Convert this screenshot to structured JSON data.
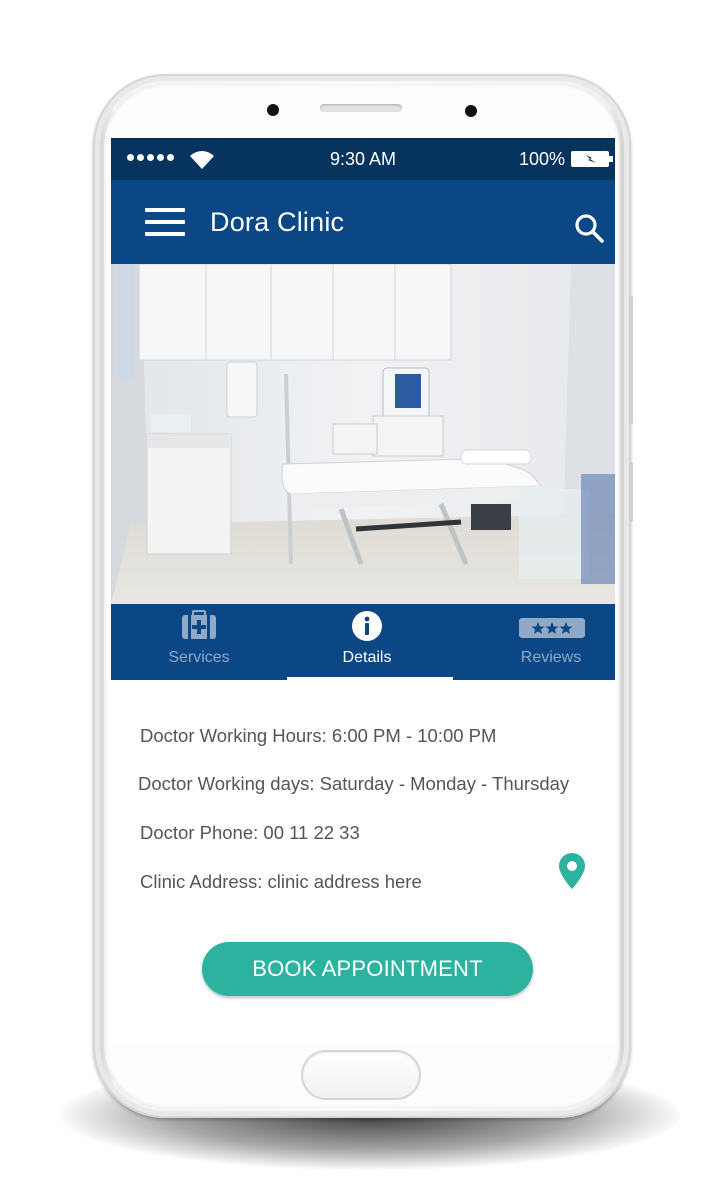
{
  "status_bar": {
    "time": "9:30 AM",
    "battery": "100%"
  },
  "app_bar": {
    "title": "Dora Clinic"
  },
  "tabs": [
    {
      "label": "Services",
      "icon": "medical-kit-icon",
      "active": false
    },
    {
      "label": "Details",
      "icon": "info-icon",
      "active": true
    },
    {
      "label": "Reviews",
      "icon": "stars-icon",
      "active": false
    }
  ],
  "details": {
    "working_hours": "Doctor Working Hours: 6:00 PM - 10:00 PM",
    "working_days": "Doctor Working days: Saturday - Monday - Thursday",
    "phone": "Doctor Phone: 00 11 22 33",
    "address": "Clinic Address: clinic address here"
  },
  "book_button": {
    "label": "BOOK APPOINTMENT"
  },
  "colors": {
    "status_bar": "#07345f",
    "app_bar": "#0b4785",
    "accent": "#2bb3a0",
    "inactive_tab": "#8fa9c7",
    "detail_text": "#555555"
  }
}
